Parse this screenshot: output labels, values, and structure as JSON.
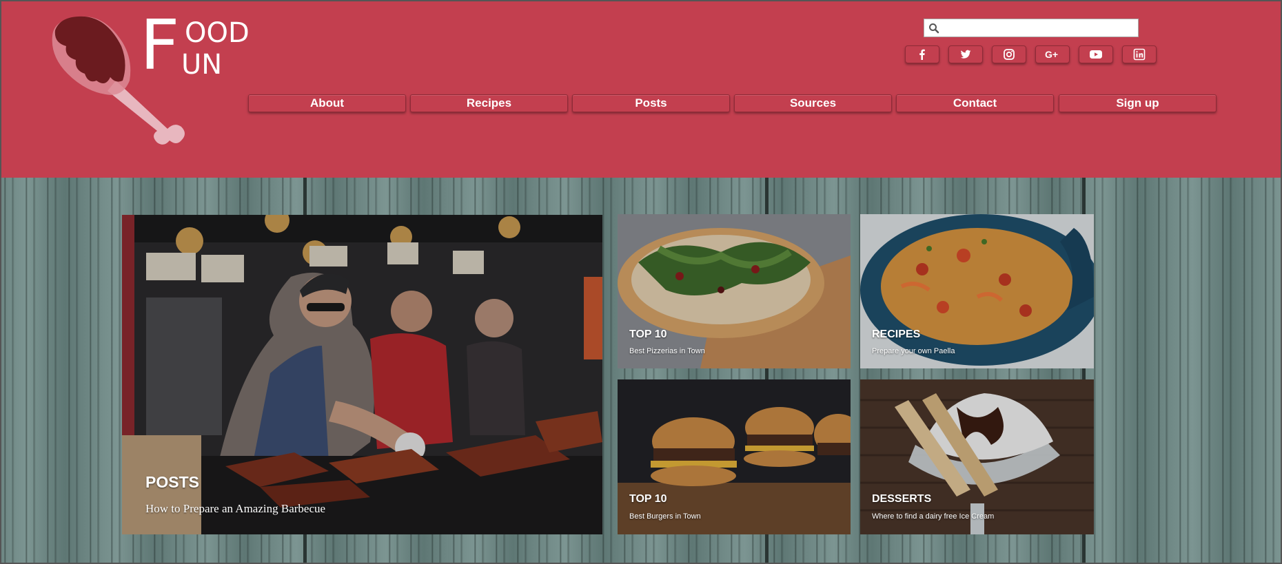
{
  "logo": {
    "line1_initial": "F",
    "line1_rest": "OOD",
    "line2": "UN"
  },
  "search": {
    "placeholder": "",
    "value": ""
  },
  "social": [
    {
      "name": "facebook-icon",
      "glyph": "f"
    },
    {
      "name": "twitter-icon",
      "glyph": "t"
    },
    {
      "name": "instagram-icon",
      "glyph": "ig"
    },
    {
      "name": "google-plus-icon",
      "glyph": "G+"
    },
    {
      "name": "youtube-icon",
      "glyph": "yt"
    },
    {
      "name": "linkedin-icon",
      "glyph": "in"
    }
  ],
  "nav": {
    "items": [
      {
        "label": "About"
      },
      {
        "label": "Recipes"
      },
      {
        "label": "Posts"
      },
      {
        "label": "Sources"
      },
      {
        "label": "Contact"
      },
      {
        "label": "Sign up"
      }
    ]
  },
  "cards": {
    "main": {
      "title": "POSTS",
      "subtitle": "How to Prepare an Amazing Barbecue"
    },
    "pizza": {
      "title": "TOP 10",
      "subtitle": "Best Pizzerias in Town"
    },
    "paella": {
      "title": "RECIPES",
      "subtitle": "Prepare your own Paella"
    },
    "burger": {
      "title": "TOP 10",
      "subtitle": "Best Burgers in Town"
    },
    "dessert": {
      "title": "DESSERTS",
      "subtitle": "Where to find a dairy free Ice Cream"
    }
  },
  "colors": {
    "header_bg": "#c33f4f",
    "button_border": "#8e2a37",
    "text_white": "#ffffff"
  }
}
